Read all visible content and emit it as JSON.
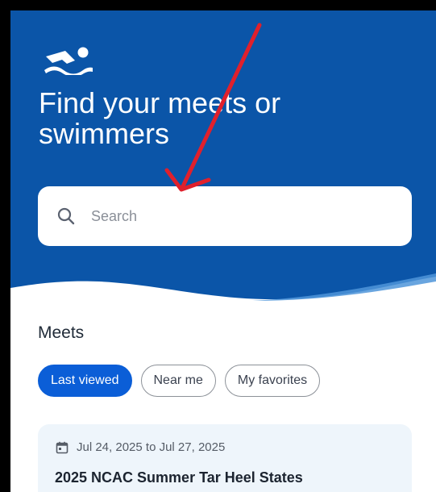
{
  "hero": {
    "title_line1": "Find your meets or",
    "title_line2": "swimmers",
    "logo_icon": "swimmer-logo-icon",
    "bg_color": "#0b55a8"
  },
  "search": {
    "icon": "search-icon",
    "placeholder": "Search"
  },
  "annotation": {
    "arrow_color": "#e0202c"
  },
  "meets": {
    "title": "Meets",
    "filters": [
      {
        "label": "Last viewed",
        "active": true
      },
      {
        "label": "Near me",
        "active": false
      },
      {
        "label": "My favorites",
        "active": false
      }
    ],
    "cards": [
      {
        "date_icon": "calendar-icon",
        "date": "Jul 24, 2025 to Jul 27, 2025",
        "title": "2025 NCAC Summer Tar Heel States"
      }
    ]
  },
  "accent_color": "#0b5ed7"
}
